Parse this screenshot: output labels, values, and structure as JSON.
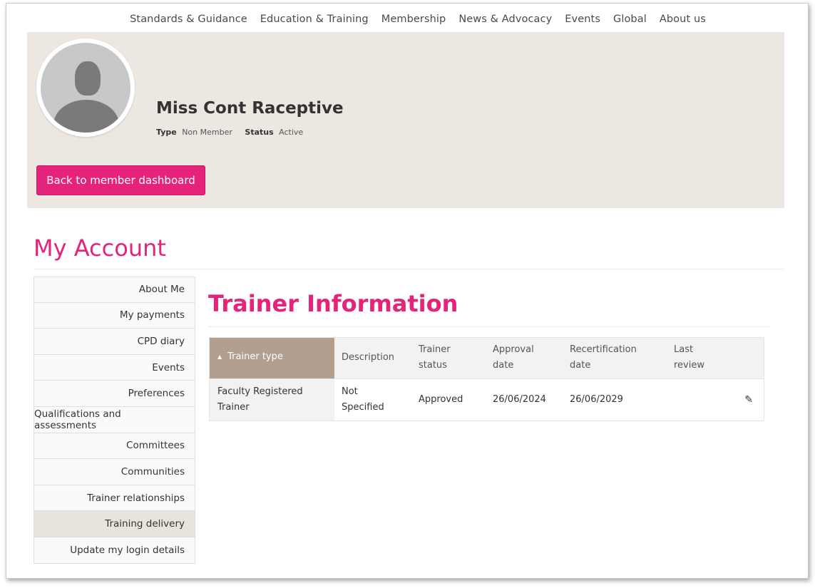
{
  "nav": {
    "items": [
      "Standards & Guidance",
      "Education & Training",
      "Membership",
      "News & Advocacy",
      "Events",
      "Global",
      "About us"
    ]
  },
  "profile": {
    "name": "Miss Cont Raceptive",
    "type_label": "Type",
    "type_value": "Non Member",
    "status_label": "Status",
    "status_value": "Active",
    "back_button": "Back to member dashboard",
    "avatar_icon": "user-silhouette-icon"
  },
  "page": {
    "title": "My Account",
    "section_title": "Trainer Information"
  },
  "sidebar": {
    "items": [
      {
        "label": "About Me"
      },
      {
        "label": "My payments"
      },
      {
        "label": "CPD diary"
      },
      {
        "label": "Events"
      },
      {
        "label": "Preferences"
      },
      {
        "label": "Qualifications and assessments"
      },
      {
        "label": "Committees"
      },
      {
        "label": "Communities"
      },
      {
        "label": "Trainer relationships"
      },
      {
        "label": "Training delivery",
        "active": true
      },
      {
        "label": "Update my login details"
      }
    ]
  },
  "table": {
    "headers": [
      "Trainer type",
      "Description",
      "Trainer status",
      "Approval date",
      "Recertification date",
      "Last review"
    ],
    "sort_icon": "sort-ascending-icon",
    "rows": [
      {
        "trainer_type": "Faculty Registered Trainer",
        "description": "Not Specified",
        "status": "Approved",
        "approval_date": "26/06/2024",
        "recertification_date": "26/06/2029",
        "last_review": "",
        "edit_icon": "pencil-icon"
      }
    ]
  },
  "colors": {
    "accent": "#e6237a",
    "banner_bg": "#ede7e2",
    "sorted_header_bg": "#b29f90"
  }
}
